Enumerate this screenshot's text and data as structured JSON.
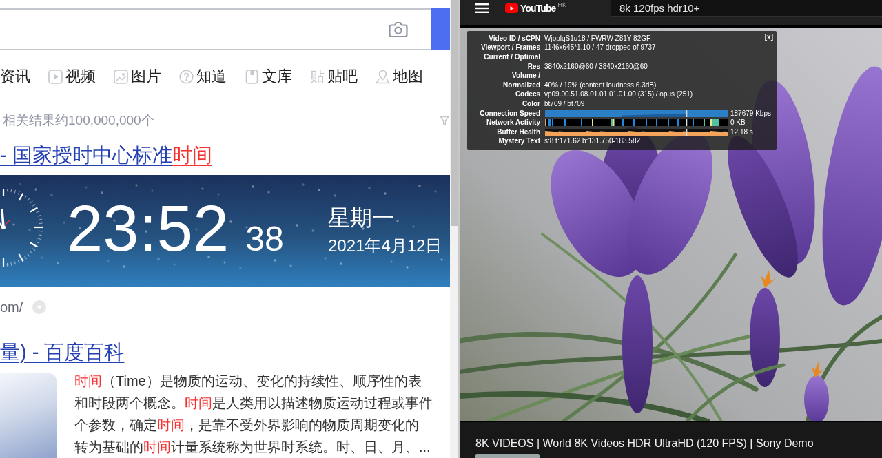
{
  "search_page": {
    "tabs": [
      {
        "kind": "plain",
        "label": "资讯"
      },
      {
        "kind": "video",
        "label": "视频"
      },
      {
        "kind": "image",
        "label": "图片"
      },
      {
        "kind": "question",
        "label": "知道"
      },
      {
        "kind": "document",
        "label": "文库"
      },
      {
        "kind": "glyph",
        "icon_text": "贴",
        "label": "贴吧"
      },
      {
        "kind": "map",
        "label": "地图"
      }
    ],
    "result_count": "相关结果约100,000,000个",
    "results": [
      {
        "kind": "clock",
        "title": [
          {
            "text": "- 国家授时中心标准",
            "highlight": false
          },
          {
            "text": "时间",
            "highlight": true
          }
        ],
        "clock": {
          "time": "23:52",
          "seconds": "38",
          "weekday": "星期一",
          "date": "2021年4月12日"
        },
        "url": "om/"
      },
      {
        "kind": "encyclopedia",
        "title": [
          {
            "text": "量) - 百度百科",
            "highlight": false
          }
        ],
        "summary": [
          [
            {
              "text": "时间",
              "highlight": true
            },
            {
              "text": "（Time）是物质的运动、变化的持续性、顺序性的表",
              "highlight": false
            }
          ],
          [
            {
              "text": "和时段两个概念。",
              "highlight": false
            },
            {
              "text": "时间",
              "highlight": true
            },
            {
              "text": "是人类用以描述物质运动过程或事件",
              "highlight": false
            }
          ],
          [
            {
              "text": "个参数，确定",
              "highlight": false
            },
            {
              "text": "时间",
              "highlight": true
            },
            {
              "text": "，是靠不受外界影响的物质周期变化的",
              "highlight": false
            }
          ],
          [
            {
              "text": "转为基础的",
              "highlight": false
            },
            {
              "text": "时间",
              "highlight": true
            },
            {
              "text": "计量系统称为世界时系统。时、日、月、...",
              "highlight": false
            }
          ]
        ]
      }
    ]
  },
  "video_page": {
    "logo": {
      "text": "YouTube",
      "region": "HK"
    },
    "search": {
      "value": "8k 120fps hdr10+"
    },
    "stats": {
      "close": "[x]",
      "rows": [
        {
          "kind": "text",
          "label": "Video ID / sCPN",
          "value": "WjoplqS1u18 / FWRW Z81Y 82GF"
        },
        {
          "kind": "text",
          "label": "Viewport / Frames",
          "value": "1146x645*1.10 / 47 dropped of 9737"
        },
        {
          "kind": "text",
          "label": "Current / Optimal"
        },
        {
          "kind": "text",
          "label": "Res",
          "value": "3840x2160@60 / 3840x2160@60"
        },
        {
          "kind": "text",
          "label": "Volume /"
        },
        {
          "kind": "text",
          "label": "Normalized",
          "value": "40% / 19% (content loudness 6.3dB)"
        },
        {
          "kind": "text",
          "label": "Codecs",
          "value": "vp09.00.51.08.01.01.01.01.00 (315) / opus (251)"
        },
        {
          "kind": "text",
          "label": "Color",
          "value": "bt709 / bt709"
        },
        {
          "kind": "speed-graph",
          "label": "Connection Speed",
          "reading": "187679 Kbps"
        },
        {
          "kind": "activity-graph",
          "label": "Network Activity",
          "reading": "0 KB"
        },
        {
          "kind": "buffer-graph",
          "label": "Buffer Health",
          "reading": "12.18 s"
        },
        {
          "kind": "text",
          "label": "Mystery Text",
          "value": "s:8 t:171.62 b:131.750-183.582"
        }
      ]
    },
    "video_title": "8K VIDEOS | World 8K Videos HDR UltraHD (120 FPS) | Sony Demo"
  }
}
